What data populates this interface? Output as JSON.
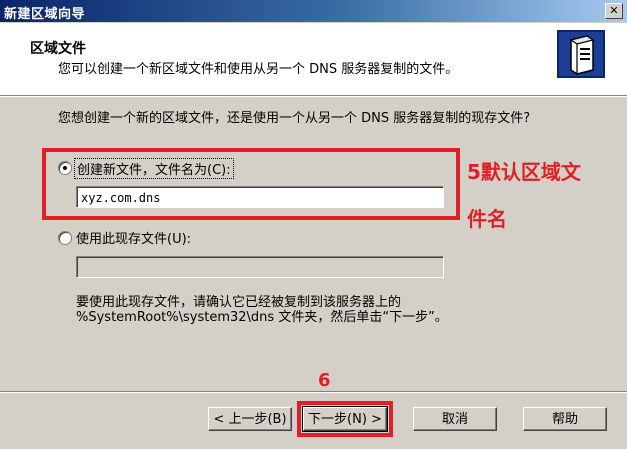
{
  "window": {
    "title": "新建区域向导",
    "close_glyph": "✕"
  },
  "header": {
    "title": "区域文件",
    "subtitle": "您可以创建一个新区域文件和使用从另一个 DNS 服务器复制的文件。",
    "icon": "server-icon"
  },
  "body": {
    "question": "您想创建一个新的区域文件，还是使用一个从另一个 DNS 服务器复制的现存文件?",
    "option_new": {
      "label": "创建新文件，文件名为(C):",
      "value": "xyz.com.dns",
      "checked": true
    },
    "option_existing": {
      "label": "使用此现存文件(U):",
      "value": "",
      "checked": false
    },
    "note_line1": "要使用此现存文件，请确认它已经被复制到该服务器上的",
    "note_line2": "%SystemRoot%\\system32\\dns 文件夹，然后单击“下一步”。"
  },
  "buttons": {
    "back": "< 上一步(B)",
    "next": "下一步(N) >",
    "cancel": "取消",
    "help": "帮助"
  },
  "annotations": {
    "step5_line1": "5默认区域文",
    "step5_line2": "件名",
    "step6": "6",
    "color": "#e21f26"
  }
}
